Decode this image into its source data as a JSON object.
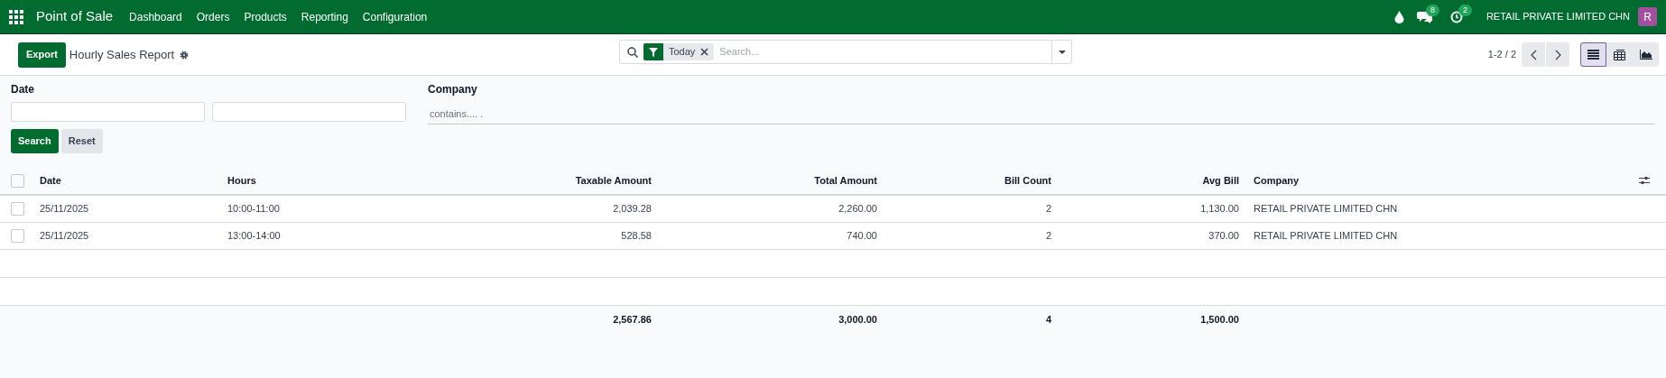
{
  "navbar": {
    "app_name": "Point of Sale",
    "menu": [
      "Dashboard",
      "Orders",
      "Products",
      "Reporting",
      "Configuration"
    ],
    "messages_badge": "8",
    "activities_badge": "2",
    "company": "RETAIL PRIVATE LIMITED CHN",
    "avatar": "R"
  },
  "control_panel": {
    "export_button": "Export",
    "title": "Hourly Sales Report",
    "search": {
      "facet": "Today",
      "placeholder": "Search..."
    },
    "pager": "1-2 / 2",
    "views": [
      {
        "kind": "list",
        "selected": true
      },
      {
        "kind": "pivot",
        "selected": false
      },
      {
        "kind": "graph",
        "selected": false
      }
    ]
  },
  "filters": {
    "date_label": "Date",
    "company_label": "Company",
    "company_placeholder": "contains.... .",
    "search_button": "Search",
    "reset_button": "Reset"
  },
  "table": {
    "all_selected": false,
    "columns": [
      "Date",
      "Hours",
      "Taxable Amount",
      "Total Amount",
      "Bill Count",
      "Avg Bill",
      "Company"
    ],
    "rows": [
      {
        "selected": false,
        "cells": [
          "25/11/2025",
          "10:00-11:00",
          "2,039.28",
          "2,260.00",
          "2",
          "1,130.00",
          "RETAIL PRIVATE LIMITED CHN"
        ]
      },
      {
        "selected": false,
        "cells": [
          "25/11/2025",
          "13:00-14:00",
          "528.58",
          "740.00",
          "2",
          "370.00",
          "RETAIL PRIVATE LIMITED CHN"
        ]
      }
    ],
    "totals": [
      "2,567.86",
      "3,000.00",
      "4",
      "1,500.00"
    ]
  }
}
